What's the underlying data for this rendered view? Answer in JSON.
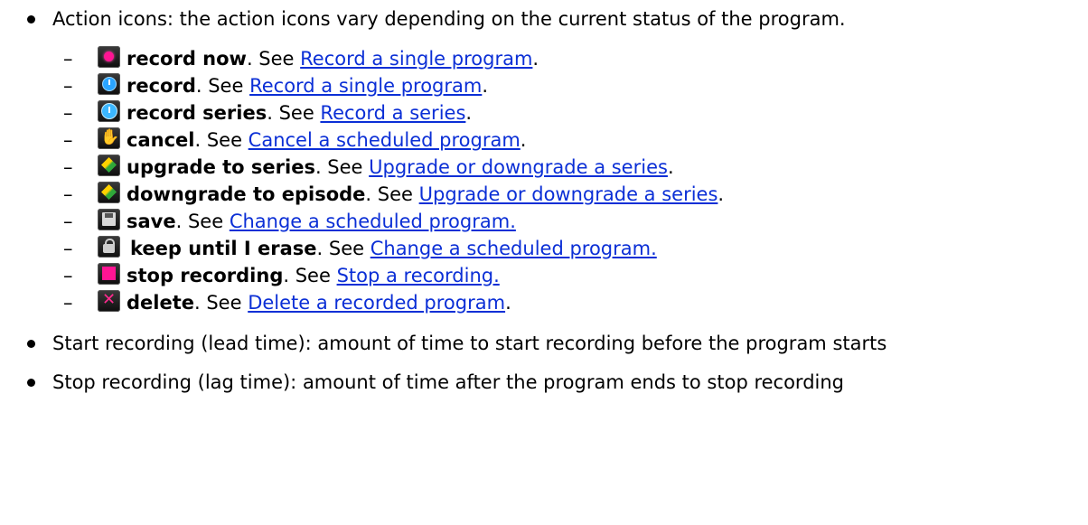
{
  "intro_bullet": {
    "label": "Action icons: the action icons vary depending on the current status of the program."
  },
  "actions": [
    {
      "icon": "record-now-icon",
      "name": "record now",
      "see": ". See ",
      "link": "Record a single program",
      "end": "."
    },
    {
      "icon": "record-icon",
      "name": "record",
      "see": ". See ",
      "link": "Record a single program",
      "end": "."
    },
    {
      "icon": "record-series-icon",
      "name": "record series",
      "see": ". See ",
      "link": "Record a series",
      "end": "."
    },
    {
      "icon": "cancel-icon",
      "name": "cancel",
      "see": ". See ",
      "link": "Cancel a scheduled program",
      "end": "."
    },
    {
      "icon": "upgrade-to-series-icon",
      "name": "upgrade to series",
      "see": ". See ",
      "link": "Upgrade or downgrade a series",
      "end": "."
    },
    {
      "icon": "downgrade-to-episode-icon",
      "name": "downgrade to episode",
      "see": ". See ",
      "link": "Upgrade or downgrade a series",
      "end": "."
    },
    {
      "icon": "save-icon",
      "name": "save",
      "see": ". See ",
      "link": "Change a scheduled program.",
      "end": ""
    },
    {
      "icon": "keep-until-erase-icon",
      "name": "keep until I erase",
      "see": ". See ",
      "link": "Change a scheduled program.",
      "end": ""
    },
    {
      "icon": "stop-recording-icon",
      "name": "stop recording",
      "see": ". See ",
      "link": "Stop a recording.",
      "end": ""
    },
    {
      "icon": "delete-icon",
      "name": "delete",
      "see": ". See ",
      "link": "Delete a recorded program",
      "end": "."
    }
  ],
  "dash": "–",
  "bullets": [
    "Start recording (lead time): amount of time to start recording before the program starts",
    "Stop recording (lag time): amount of time after the program ends to stop recording"
  ],
  "colors": {
    "link": "#0b2fd6",
    "pink_accent": "#ff1493",
    "clock_blue": "#2aa4ff"
  }
}
